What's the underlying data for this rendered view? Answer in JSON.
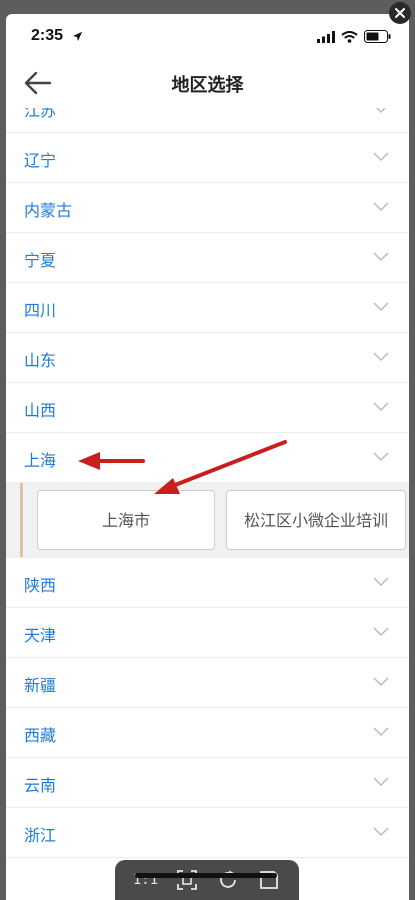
{
  "status": {
    "time": "2:35"
  },
  "nav": {
    "title": "地区选择"
  },
  "regions_before": [
    {
      "label": "江苏"
    },
    {
      "label": "辽宁"
    },
    {
      "label": "内蒙古"
    },
    {
      "label": "宁夏"
    },
    {
      "label": "四川"
    },
    {
      "label": "山东"
    },
    {
      "label": "山西"
    },
    {
      "label": "上海"
    }
  ],
  "expanded": {
    "cities": [
      {
        "label": "上海市"
      },
      {
        "label": "松江区小微企业培训"
      }
    ]
  },
  "regions_after": [
    {
      "label": "陕西"
    },
    {
      "label": "天津"
    },
    {
      "label": "新疆"
    },
    {
      "label": "西藏"
    },
    {
      "label": "云南"
    },
    {
      "label": "浙江"
    }
  ],
  "toolbar": {
    "actual_size_label": "1:1"
  },
  "colors": {
    "link": "#1f7bd8",
    "annotation": "#c81e1e",
    "accent": "#d9c4a3"
  }
}
